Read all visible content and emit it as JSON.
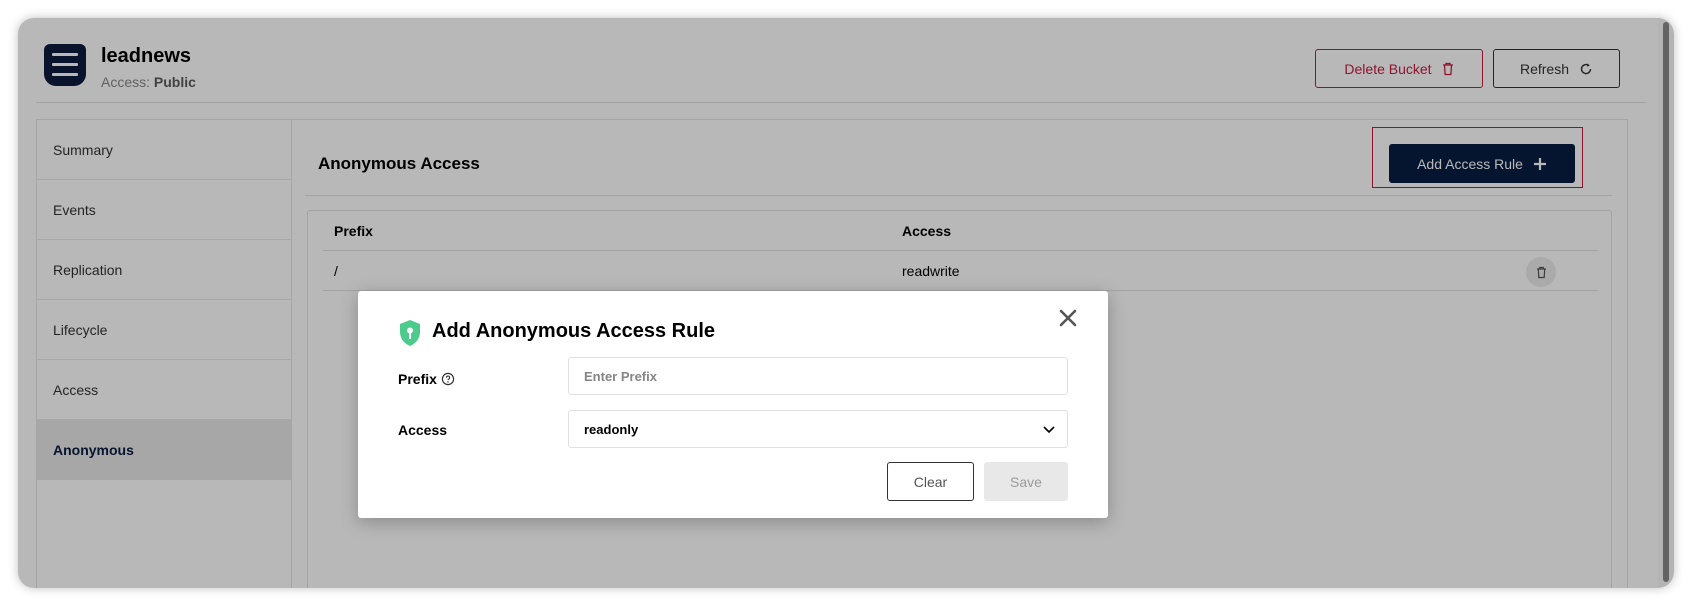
{
  "bucket": {
    "name": "leadnews",
    "access_label": "Access:",
    "access_value": "Public"
  },
  "header": {
    "delete_label": "Delete Bucket",
    "refresh_label": "Refresh"
  },
  "sidebar": {
    "items": [
      {
        "label": "Summary"
      },
      {
        "label": "Events"
      },
      {
        "label": "Replication"
      },
      {
        "label": "Lifecycle"
      },
      {
        "label": "Access"
      },
      {
        "label": "Anonymous"
      }
    ],
    "active": "Anonymous"
  },
  "main": {
    "title": "Anonymous Access",
    "add_label": "Add Access Rule",
    "table": {
      "columns": [
        "Prefix",
        "Access"
      ],
      "rows": [
        {
          "prefix": "/",
          "access": "readwrite"
        }
      ]
    }
  },
  "modal": {
    "title": "Add Anonymous Access Rule",
    "prefix_label": "Prefix",
    "prefix_placeholder": "Enter Prefix",
    "prefix_value": "",
    "access_label": "Access",
    "access_value": "readonly",
    "clear_label": "Clear",
    "save_label": "Save"
  },
  "colors": {
    "brand": "#081c42",
    "danger": "#c51b3f",
    "shield": "#4ccb8d"
  },
  "icons": [
    "bucket-icon",
    "trash-icon",
    "refresh-icon",
    "plus-icon",
    "shield-icon",
    "close-icon",
    "help-icon",
    "chevron-down-icon"
  ]
}
